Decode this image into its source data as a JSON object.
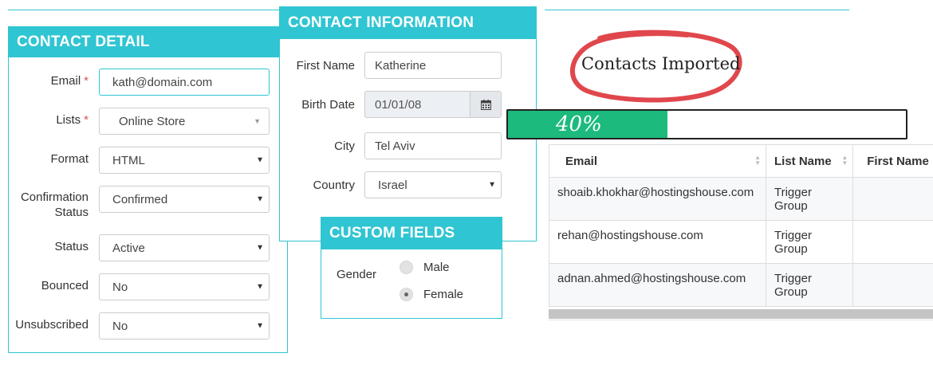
{
  "contact_detail": {
    "title": "CONTACT DETAIL",
    "email_label": "Email",
    "email_value": "kath@domain.com",
    "lists_label": "Lists",
    "lists_value": "Online Store",
    "format_label": "Format",
    "format_value": "HTML",
    "confirmation_label_1": "Confirmation",
    "confirmation_label_2": "Status",
    "confirmation_value": "Confirmed",
    "status_label": "Status",
    "status_value": "Active",
    "bounced_label": "Bounced",
    "bounced_value": "No",
    "unsubscribed_label": "Unsubscribed",
    "unsubscribed_value": "No",
    "required_mark": "*"
  },
  "contact_information": {
    "title": "CONTACT INFORMATION",
    "first_name_label": "First Name",
    "first_name_value": "Katherine",
    "birth_date_label": "Birth Date",
    "birth_date_value": "01/01/08",
    "city_label": "City",
    "city_value": "Tel Aviv",
    "country_label": "Country",
    "country_value": "Israel"
  },
  "custom_fields": {
    "title": "CUSTOM FIELDS",
    "gender_label": "Gender",
    "options": [
      "Male",
      "Female"
    ],
    "selected": "Female"
  },
  "import": {
    "heading": "Contacts Imported",
    "progress_text": "40%",
    "progress_fraction": 0.4,
    "accent_color": "#1dba7d",
    "circle_color": "#e0474c"
  },
  "table": {
    "headers": [
      "Email",
      "List Name",
      "First Name"
    ],
    "rows": [
      [
        "shoaib.khokhar@hostingshouse.com",
        "Trigger Group",
        ""
      ],
      [
        "rehan@hostingshouse.com",
        "Trigger Group",
        ""
      ],
      [
        "adnan.ahmed@hostingshouse.com",
        "Trigger Group",
        ""
      ]
    ]
  },
  "colors": {
    "panel_accent": "#30c5d2",
    "required": "#d9534f"
  }
}
